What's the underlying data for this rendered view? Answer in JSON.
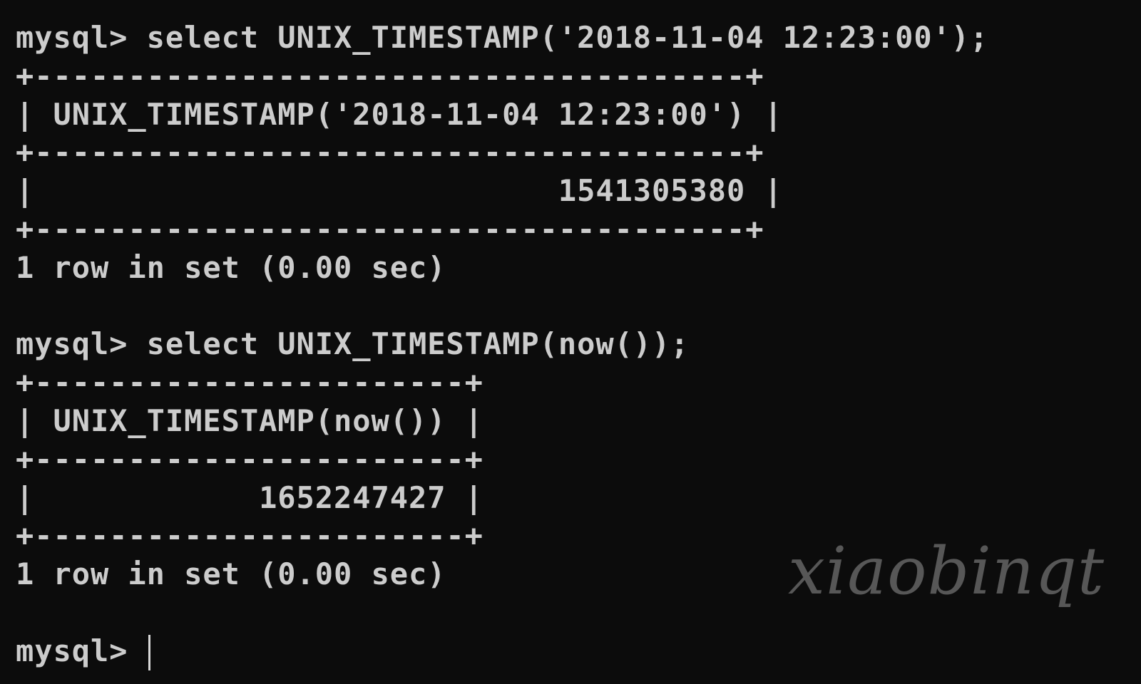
{
  "terminal": {
    "lines": [
      "mysql> select UNIX_TIMESTAMP('2018-11-04 12:23:00');",
      "+--------------------------------------+",
      "| UNIX_TIMESTAMP('2018-11-04 12:23:00') |",
      "+--------------------------------------+",
      "|                            1541305380 |",
      "+--------------------------------------+",
      "1 row in set (0.00 sec)",
      "",
      "mysql> select UNIX_TIMESTAMP(now());",
      "+-----------------------+",
      "| UNIX_TIMESTAMP(now()) |",
      "+-----------------------+",
      "|            1652247427 |",
      "+-----------------------+",
      "1 row in set (0.00 sec)",
      "",
      "mysql> "
    ]
  },
  "watermark": "xiaobinqt",
  "colors": {
    "background": "#0c0c0c",
    "text": "#cccccc",
    "watermark": "#6a6a6a"
  }
}
